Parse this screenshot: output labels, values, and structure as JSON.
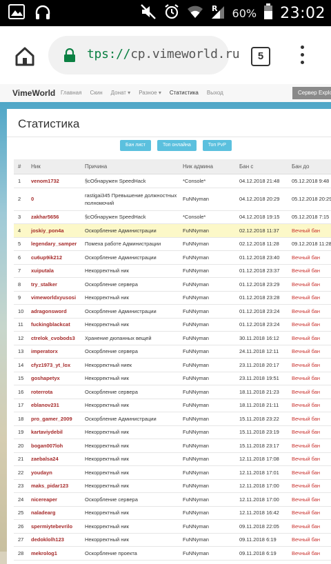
{
  "status_bar": {
    "battery_percent": "60%",
    "time": "23:02",
    "icons": [
      "image-icon",
      "headphones-icon",
      "mute-icon",
      "alarm-icon",
      "wifi-icon",
      "signal-icon",
      "battery-icon"
    ]
  },
  "browser": {
    "url_scheme": "tps://",
    "url_host": "cp.vimeworld.ru",
    "tab_count": "5",
    "colors": {
      "lock": "#0b8043",
      "toolbar": "#ffffff"
    }
  },
  "site": {
    "brand": "VimeWorld",
    "nav": [
      "Главная",
      "Скин",
      "Донат ▾",
      "Разное ▾",
      "Статистика",
      "Выход"
    ],
    "server_button": "Сервер Explorer"
  },
  "page": {
    "title": "Статистика",
    "buttons": [
      "Бан лист",
      "Топ онлайна",
      "Топ PvP"
    ]
  },
  "table": {
    "headers": [
      "#",
      "Ник",
      "Причина",
      "Ник админа",
      "Бан с",
      "Бан до"
    ],
    "rows": [
      {
        "n": "1",
        "nick": "venom1732",
        "reason": "§cОбнаружен SpeedHack",
        "admin": "*Console*",
        "from": "04.12.2018 21:48",
        "to": "05.12.2018 9:48"
      },
      {
        "n": "2",
        "nick": "0",
        "reason": "rastigai345 Превышение должностных полномочий",
        "admin": "FuNNyman",
        "from": "04.12.2018 20:29",
        "to": "05.12.2018 20:29"
      },
      {
        "n": "3",
        "nick": "zakhar5656",
        "reason": "§cОбнаружен SpeedHack",
        "admin": "*Console*",
        "from": "04.12.2018 19:15",
        "to": "05.12.2018 7:15"
      },
      {
        "n": "4",
        "nick": "joskiy_pon4a",
        "reason": "Оскорбление Администрации",
        "admin": "FuNNyman",
        "from": "02.12.2018 11:37",
        "to": "Вечный бан"
      },
      {
        "n": "5",
        "nick": "legendary_samper",
        "reason": "Помеха работе Администрации",
        "admin": "FuNNyman",
        "from": "02.12.2018 11:28",
        "to": "09.12.2018 11:28"
      },
      {
        "n": "6",
        "nick": "cu6up9ik212",
        "reason": "Оскорбление Администрации",
        "admin": "FuNNyman",
        "from": "01.12.2018 23:40",
        "to": "Вечный бан"
      },
      {
        "n": "7",
        "nick": "xuiputala",
        "reason": "Некорректный ник",
        "admin": "FuNNyman",
        "from": "01.12.2018 23:37",
        "to": "Вечный бан"
      },
      {
        "n": "8",
        "nick": "try_stalker",
        "reason": "Оскорбление сервера",
        "admin": "FuNNyman",
        "from": "01.12.2018 23:29",
        "to": "Вечный бан"
      },
      {
        "n": "9",
        "nick": "vimeworldxyusosi",
        "reason": "Некорректный ник",
        "admin": "FuNNyman",
        "from": "01.12.2018 23:28",
        "to": "Вечный бан"
      },
      {
        "n": "10",
        "nick": "adragonsword",
        "reason": "Оскорбление Администрации",
        "admin": "FuNNyman",
        "from": "01.12.2018 23:24",
        "to": "Вечный бан"
      },
      {
        "n": "11",
        "nick": "fuckingblackcat",
        "reason": "Некорректный ник",
        "admin": "FuNNyman",
        "from": "01.12.2018 23:24",
        "to": "Вечный бан"
      },
      {
        "n": "12",
        "nick": "ctrelok_cvobods3",
        "reason": "Хранение дюпанных вещей",
        "admin": "FuNNyman",
        "from": "30.11.2018 16:12",
        "to": "Вечный бан"
      },
      {
        "n": "13",
        "nick": "imperatorx",
        "reason": "Оскорбление сервера",
        "admin": "FuNNyman",
        "from": "24.11.2018 12:11",
        "to": "Вечный бан"
      },
      {
        "n": "14",
        "nick": "cfyz1973_yt_lox",
        "reason": "Некорректный ниек",
        "admin": "FuNNyman",
        "from": "23.11.2018 20:17",
        "to": "Вечный бан"
      },
      {
        "n": "15",
        "nick": "goshapetyx",
        "reason": "Некорректный ник",
        "admin": "FuNNyman",
        "from": "23.11.2018 19:51",
        "to": "Вечный бан"
      },
      {
        "n": "16",
        "nick": "roterrota",
        "reason": "Оскорбление сервера",
        "admin": "FuNNyman",
        "from": "18.11.2018 21:23",
        "to": "Вечный бан"
      },
      {
        "n": "17",
        "nick": "eblanov231",
        "reason": "Некорректный ник",
        "admin": "FuNNyman",
        "from": "18.11.2018 21:11",
        "to": "Вечный бан"
      },
      {
        "n": "18",
        "nick": "pro_gamer_2009",
        "reason": "Оскорбление Администрации",
        "admin": "FuNNyman",
        "from": "15.11.2018 23:22",
        "to": "Вечный бан"
      },
      {
        "n": "19",
        "nick": "kartaviydebil",
        "reason": "Некорректный ник",
        "admin": "FuNNyman",
        "from": "15.11.2018 23:19",
        "to": "Вечный бан"
      },
      {
        "n": "20",
        "nick": "bogan007loh",
        "reason": "Некорректный ник",
        "admin": "FuNNyman",
        "from": "15.11.2018 23:17",
        "to": "Вечный бан"
      },
      {
        "n": "21",
        "nick": "zaebalsa24",
        "reason": "Некорректный ник",
        "admin": "FuNNyman",
        "from": "12.11.2018 17:08",
        "to": "Вечный бан"
      },
      {
        "n": "22",
        "nick": "youdayn",
        "reason": "Некорректный ник",
        "admin": "FuNNyman",
        "from": "12.11.2018 17:01",
        "to": "Вечный бан"
      },
      {
        "n": "23",
        "nick": "maks_pidar123",
        "reason": "Некорректный ник",
        "admin": "FuNNyman",
        "from": "12.11.2018 17:00",
        "to": "Вечный бан"
      },
      {
        "n": "24",
        "nick": "nicereaper",
        "reason": "Оскорбление сервера",
        "admin": "FuNNyman",
        "from": "12.11.2018 17:00",
        "to": "Вечный бан"
      },
      {
        "n": "25",
        "nick": "naladearg",
        "reason": "Некорректный ник",
        "admin": "FuNNyman",
        "from": "12.11.2018 16:42",
        "to": "Вечный бан"
      },
      {
        "n": "26",
        "nick": "spermiytebevrilo",
        "reason": "Некорректный ник",
        "admin": "FuNNyman",
        "from": "09.11.2018 22:05",
        "to": "Вечный бан"
      },
      {
        "n": "27",
        "nick": "dedoklolh123",
        "reason": "Некорректный ник",
        "admin": "FuNNyman",
        "from": "09.11.2018 6:19",
        "to": "Вечный бан"
      },
      {
        "n": "28",
        "nick": "mekrolog1",
        "reason": "Оскорбление проекта",
        "admin": "FuNNyman",
        "from": "09.11.2018 6:19",
        "to": "Вечный бан"
      }
    ],
    "permanent_label": "Вечный бан",
    "highlighted_row": "4",
    "colors": {
      "nick": "#a52a2a",
      "permanent": "#c9302c",
      "highlight": "#fcf8c8",
      "button": "#5bc0de"
    }
  }
}
